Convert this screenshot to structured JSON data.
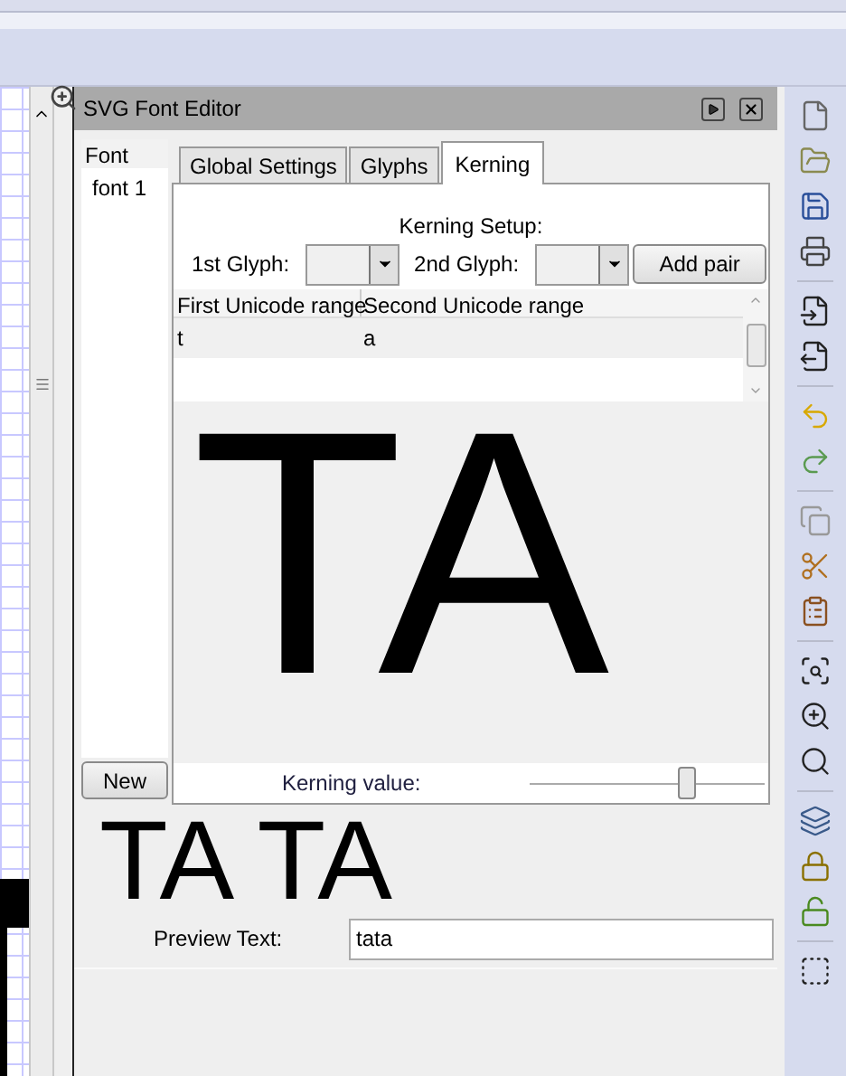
{
  "dialog": {
    "title": "SVG Font Editor"
  },
  "font_list": {
    "header": "Font",
    "items": [
      {
        "label": "font 1"
      }
    ],
    "new_button": "New"
  },
  "tabs": [
    {
      "label": "Global Settings",
      "selected": false
    },
    {
      "label": "Glyphs",
      "selected": false
    },
    {
      "label": "Kerning",
      "selected": true
    }
  ],
  "kerning": {
    "heading": "Kerning Setup:",
    "first_glyph_label": "1st Glyph:",
    "second_glyph_label": "2nd Glyph:",
    "add_button": "Add pair",
    "columns": [
      "First Unicode range",
      "Second Unicode range"
    ],
    "rows": [
      {
        "first": "t",
        "second": "a"
      }
    ],
    "glyph_preview": "TA",
    "kerning_label": "Kerning value:",
    "kerning_slider": {
      "level": 0.67
    }
  },
  "preview": {
    "sample": "TA TA",
    "label": "Preview Text:",
    "value": "tata"
  }
}
